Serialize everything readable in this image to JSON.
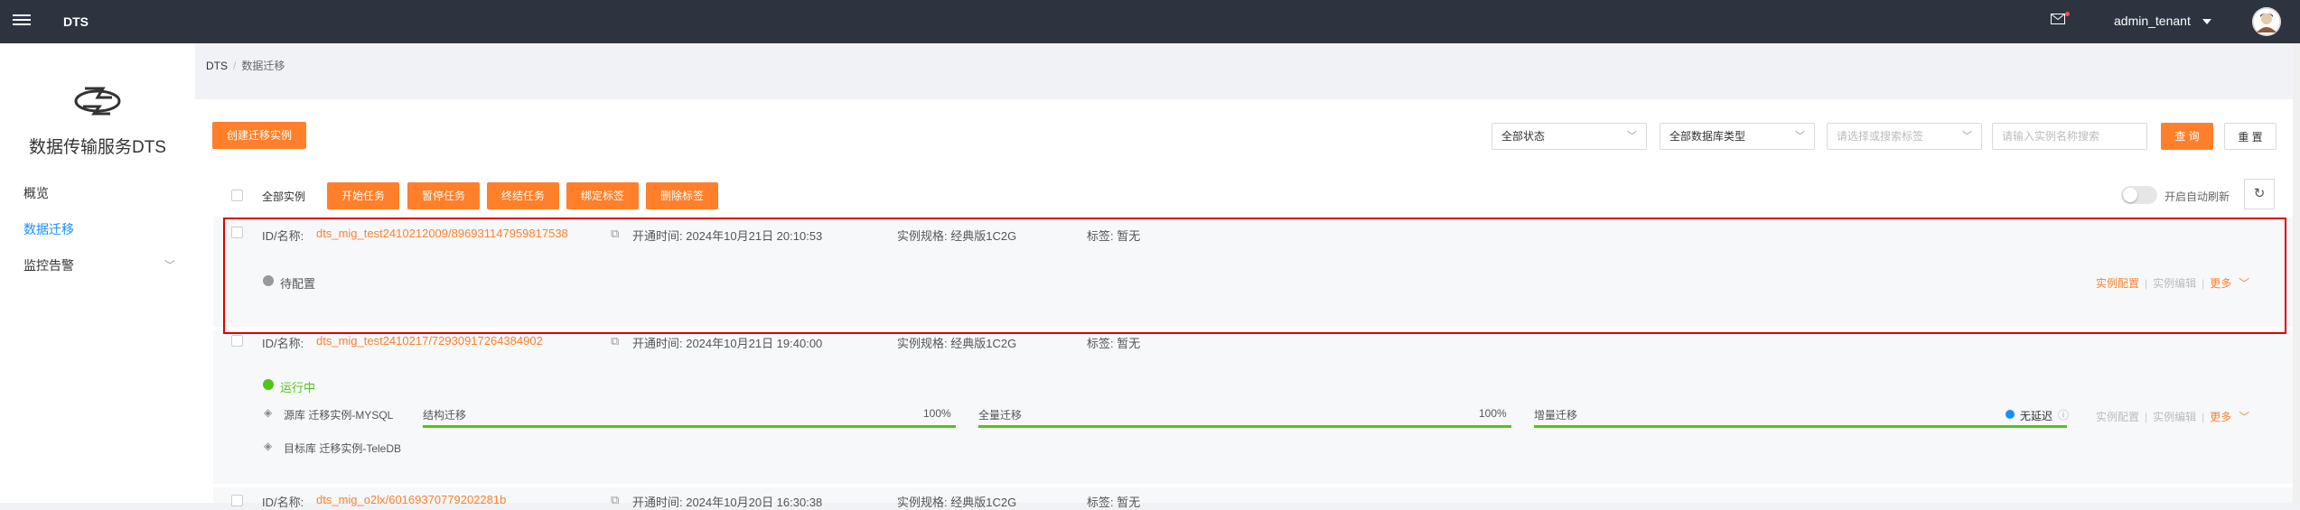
{
  "header": {
    "app_title": "DTS",
    "username": "admin_tenant"
  },
  "sidebar": {
    "brand": "数据传输服务DTS",
    "items": [
      {
        "label": "概览"
      },
      {
        "label": "数据迁移"
      },
      {
        "label": "监控告警"
      }
    ]
  },
  "breadcrumb": {
    "root": "DTS",
    "current": "数据迁移"
  },
  "toolbar": {
    "create_label": "创建迁移实例",
    "status_select": "全部状态",
    "db_type_select": "全部数据库类型",
    "tag_placeholder": "请选择或搜索标签",
    "search_placeholder": "请输入实例名称搜索",
    "query_label": "查 询",
    "reset_label": "重 置"
  },
  "batch": {
    "all_label": "全部实例",
    "start_label": "开始任务",
    "pause_label": "暂停任务",
    "stop_label": "终结任务",
    "bind_tag_label": "绑定标签",
    "delete_tag_label": "删除标签",
    "auto_refresh_label": "开启自动刷新"
  },
  "instances": [
    {
      "id_prefix": "ID/名称:",
      "id_name": "dts_mig_test2410212009/896931147959817538",
      "open_time": "开通时间:  2024年10月21日 20:10:53",
      "spec": "实例规格: 经典版1C2G",
      "tag": "标签: 暂无",
      "status": "待配置",
      "actions": [
        "实例配置",
        "实例编辑",
        "更多"
      ]
    },
    {
      "id_prefix": "ID/名称:",
      "id_name": "dts_mig_test2410217/72930917264384902",
      "open_time": "开通时间:  2024年10月21日 19:40:00",
      "spec": "实例规格: 经典版1C2G",
      "tag": "标签: 暂无",
      "status": "运行中",
      "source": "源库  迁移实例-MYSQL",
      "target": "目标库  迁移实例-TeleDB",
      "stages": [
        {
          "label": "结构迁移",
          "percent": "100%",
          "progress": 1.0
        },
        {
          "label": "全量迁移",
          "percent": "100%",
          "progress": 1.0
        },
        {
          "label": "增量迁移",
          "extra": "无延迟",
          "progress": 1.0
        }
      ],
      "actions": [
        "实例配置",
        "实例编辑",
        "更多"
      ]
    },
    {
      "id_prefix": "ID/名称:",
      "id_name": "dts_mig_o2lx/60169370779202281b",
      "open_time": "开通时间:  2024年10月20日 16:30:38",
      "spec": "实例规格: 经典版1C2G",
      "tag": "标签: 暂无"
    }
  ],
  "colors": {
    "accent": "#ff7f2a",
    "topbar": "#2d3440",
    "link": "#1890ff",
    "success": "#52c41a",
    "highlight": "#e00000"
  }
}
